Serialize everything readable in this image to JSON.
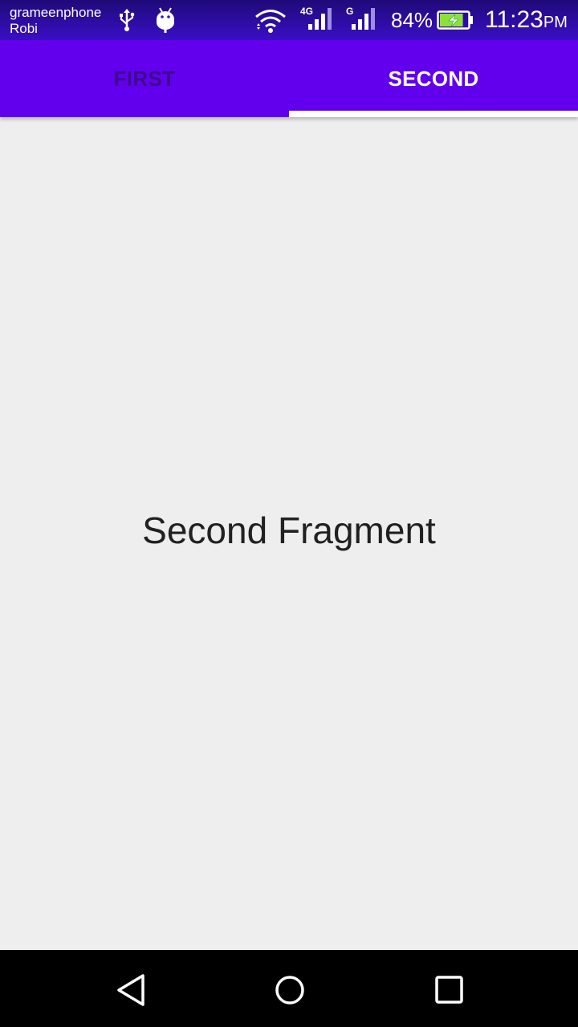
{
  "status_bar": {
    "carrier_primary": "grameenphone",
    "carrier_secondary": "Robi",
    "network_1_label": "4G",
    "network_2_label": "G",
    "battery_percent": "84%",
    "battery_level": 0.84,
    "time": "11:23",
    "time_suffix": "PM",
    "icons": [
      "usb-icon",
      "android-debug-icon",
      "wifi-icon",
      "signal-4g-icon",
      "signal-g-icon",
      "battery-charging-icon"
    ]
  },
  "tabs": [
    {
      "label": "FIRST",
      "selected": false
    },
    {
      "label": "SECOND",
      "selected": true
    }
  ],
  "content": {
    "text": "Second Fragment"
  },
  "nav_bar": {
    "icons": [
      "back-icon",
      "home-icon",
      "recents-icon"
    ]
  },
  "colors": {
    "tab_bar": "#6200ee",
    "tab_selected_text": "#ffffff",
    "tab_unselected_text": "#3d0a8c",
    "indicator": "#ffffff",
    "background": "#eeeeee",
    "nav_bar": "#000000",
    "battery_fill": "#8ee03a"
  }
}
